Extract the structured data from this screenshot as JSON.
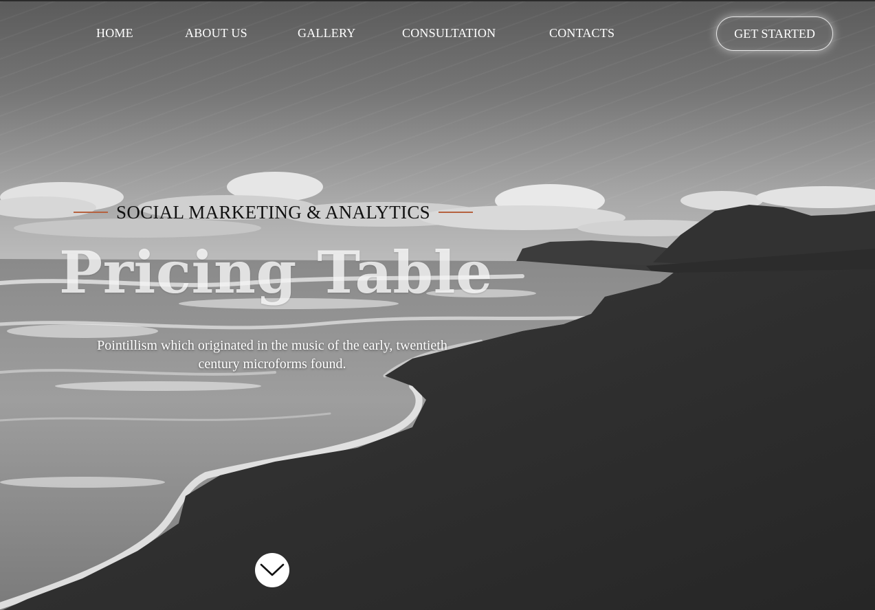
{
  "nav": {
    "items": [
      {
        "label": "HOME"
      },
      {
        "label": "ABOUT US"
      },
      {
        "label": "GALLERY"
      },
      {
        "label": "CONSULTATION"
      },
      {
        "label": "CONTACTS"
      }
    ],
    "cta_label": "GET STARTED"
  },
  "hero": {
    "eyebrow": "SOCIAL MARKETING & ANALYTICS",
    "title": "Pricing Table",
    "subtitle_line1": "Pointillism which originated in the music of the early, twentieth",
    "subtitle_line2": "century microforms found.",
    "scroll_icon": "chevron-down-icon"
  },
  "colors": {
    "accent_line": "#b5613e",
    "text_light": "#ffffff",
    "eyebrow_text": "#111111"
  }
}
